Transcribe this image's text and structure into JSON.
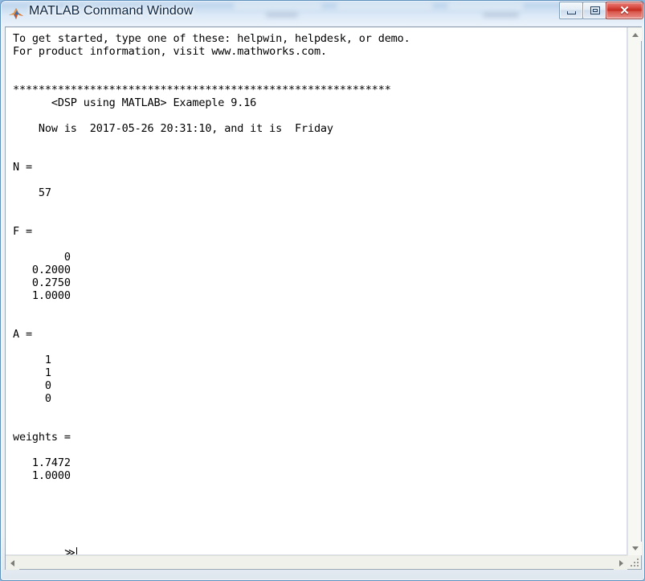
{
  "window": {
    "title": "MATLAB Command Window",
    "icon": "matlab-membrane-icon",
    "accent_close": "#c32b20",
    "titlebar_color": "#cfe0f2",
    "frame_color": "#eef2f2"
  },
  "caption_buttons": {
    "minimize_label": "—",
    "restore_label": "❐",
    "close_label": "✕",
    "minimize_name": "minimize",
    "restore_name": "restore",
    "close_name": "close"
  },
  "console": {
    "background": "#ffffff",
    "foreground": "#000000",
    "text": "To get started, type one of these: helpwin, helpdesk, or demo.\nFor product information, visit www.mathworks.com.\n\n\n***********************************************************\n      <DSP using MATLAB> Exameple 9.16\n\n    Now is  2017-05-26 20:31:10, and it is  Friday\n\n\nN =\n\n    57\n\n\nF =\n\n        0\n   0.2000\n   0.2750\n   1.0000\n\n\nA =\n\n     1\n     1\n     0\n     0\n\n\nweights =\n\n   1.7472\n   1.0000\n",
    "prompt": "≫",
    "lines": {
      "intro_1": "To get started, type one of these: helpwin, helpdesk, or demo.",
      "intro_2": "For product information, visit www.mathworks.com.",
      "separator": "***********************************************************",
      "example_header": "<DSP using MATLAB> Exameple 9.16",
      "timestamp_line": "Now is  2017-05-26 20:31:10, and it is  Friday"
    },
    "variables": [
      {
        "name": "N =",
        "values": [
          "57"
        ]
      },
      {
        "name": "F =",
        "values": [
          "0",
          "0.2000",
          "0.2750",
          "1.0000"
        ]
      },
      {
        "name": "A =",
        "values": [
          "1",
          "1",
          "0",
          "0"
        ]
      },
      {
        "name": "weights =",
        "values": [
          "1.7472",
          "1.0000"
        ]
      }
    ],
    "date": "2017-05-26",
    "time": "20:31:10",
    "weekday": "Friday",
    "example_number": "9.16"
  },
  "scrollbars": {
    "vertical": {
      "up_arrow": "scroll-up-arrow",
      "down_arrow": "scroll-down-arrow"
    },
    "horizontal": {
      "left_arrow": "scroll-left-arrow",
      "right_arrow": "scroll-right-arrow"
    },
    "resize_grip": "resize-grip"
  }
}
